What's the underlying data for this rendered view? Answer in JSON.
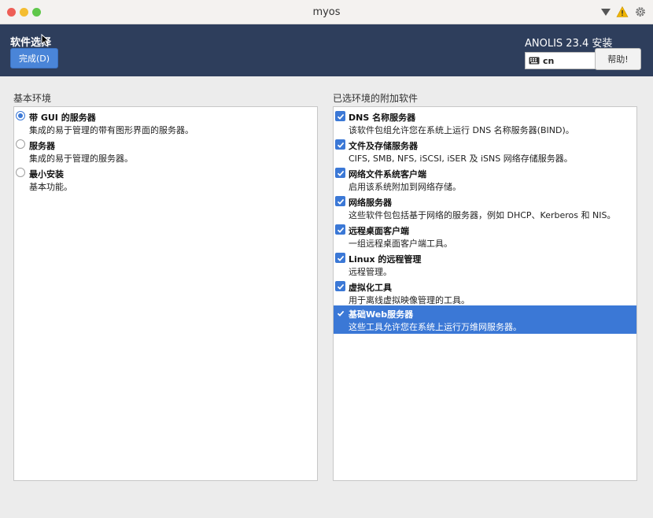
{
  "window": {
    "title": "myos"
  },
  "header": {
    "title": "软件选择",
    "done_label": "完成(D)",
    "product": "ANOLIS 23.4 安装",
    "keyboard_layout": "cn",
    "help_label": "帮助!"
  },
  "base_env": {
    "label": "基本环境",
    "items": [
      {
        "title": "带 GUI 的服务器",
        "desc": "集成的易于管理的带有图形界面的服务器。",
        "selected": true
      },
      {
        "title": "服务器",
        "desc": "集成的易于管理的服务器。",
        "selected": false
      },
      {
        "title": "最小安装",
        "desc": "基本功能。",
        "selected": false
      }
    ]
  },
  "addons": {
    "label": "已选环境的附加软件",
    "items": [
      {
        "title": "DNS 名称服务器",
        "desc": "该软件包组允许您在系统上运行 DNS 名称服务器(BIND)。",
        "checked": true
      },
      {
        "title": "文件及存储服务器",
        "desc": "CIFS, SMB, NFS, iSCSI, iSER 及 iSNS 网络存储服务器。",
        "checked": true
      },
      {
        "title": "网络文件系统客户端",
        "desc": "启用该系统附加到网络存储。",
        "checked": true
      },
      {
        "title": "网络服务器",
        "desc": "这些软件包包括基于网络的服务器，例如 DHCP、Kerberos 和 NIS。",
        "checked": true
      },
      {
        "title": "远程桌面客户端",
        "desc": "一组远程桌面客户端工具。",
        "checked": true
      },
      {
        "title": "Linux 的远程管理",
        "desc": "远程管理。",
        "checked": true
      },
      {
        "title": "虚拟化工具",
        "desc": "用于离线虚拟映像管理的工具。",
        "checked": true
      },
      {
        "title": "基础Web服务器",
        "desc": "这些工具允许您在系统上运行万维网服务器。",
        "checked": true,
        "highlighted": true
      }
    ]
  }
}
